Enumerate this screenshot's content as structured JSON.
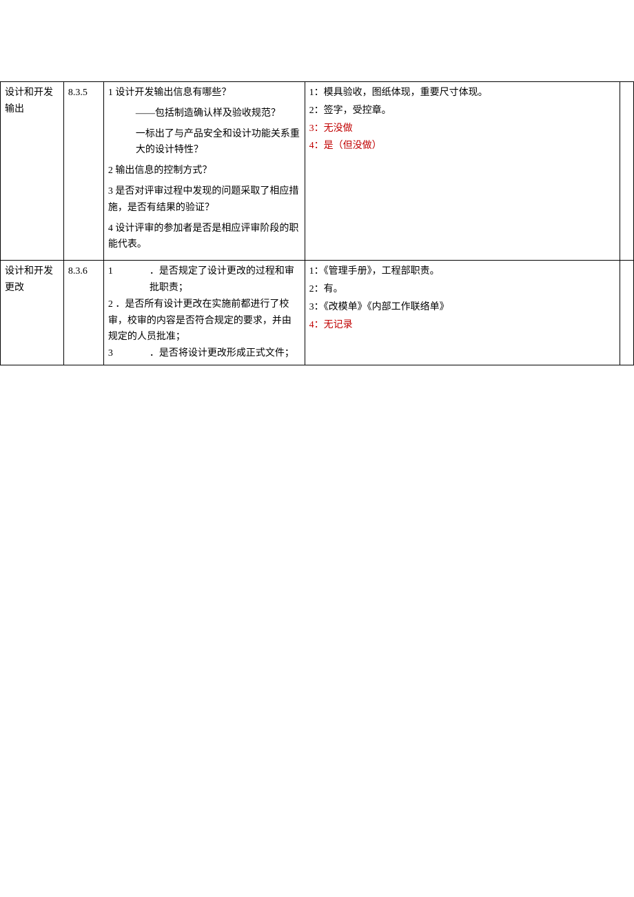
{
  "rows": [
    {
      "title": "设计和开发输出",
      "code": "8.3.5",
      "questions": {
        "q1": "1 设计开发输出信息有哪些？",
        "q1sub1": "——包括制造确认样及验收规范？",
        "q1sub2": "一标出了与产品安全和设计功能关系重大的设计特性？",
        "q2": "2 输出信息的控制方式？",
        "q3": "3 是否对评审过程中发现的问题采取了相应措施，是否有结果的验证？",
        "q4": "4 设计评审的参加者是否是相应评审阶段的职能代表。"
      },
      "answers": {
        "a1": "1：模具验收，图纸体现，重要尺寸体现。",
        "a2": "2：签字，受控章。",
        "a3": "3：无没做",
        "a4": "4：是（但没做）"
      }
    },
    {
      "title": "设计和开发更改",
      "code": "8.3.6",
      "questions": {
        "q1num": "1",
        "q1txt": "．是否规定了设计更改的过程和审批职责；",
        "q2": "2 ．是否所有设计更改在实施前都进行了校审，校审的内容是否符合规定的要求，并由规定的人员批准；",
        "q3num": "3",
        "q3txt": "．是否将设计更改形成正式文件；"
      },
      "answers": {
        "a1": "1：《管理手册》，工程部职责。",
        "a2": "2：有。",
        "a3": "3：《改模单》《内部工作联络单》",
        "a4": "4：无记录"
      }
    }
  ]
}
